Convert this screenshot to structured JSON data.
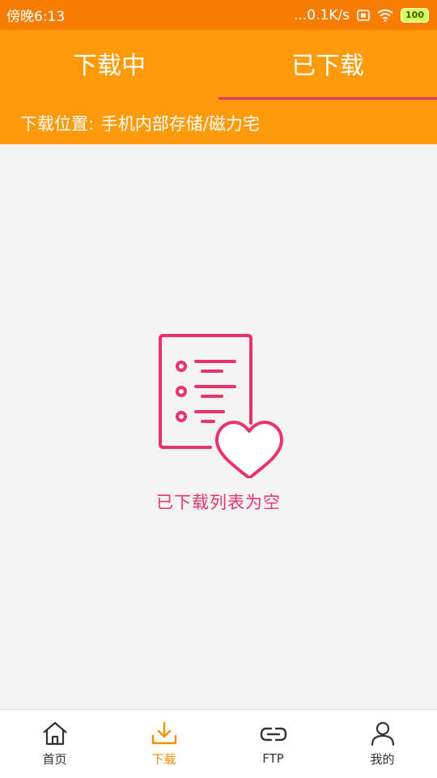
{
  "status_bar": {
    "time": "傍晚6:13",
    "speed": "...0.1K/s",
    "battery": "100"
  },
  "tabs": [
    {
      "label": "下载中",
      "active": false
    },
    {
      "label": "已下载",
      "active": true
    }
  ],
  "location": {
    "label": "下载位置:",
    "path": "手机内部存储/磁力宅"
  },
  "empty_state": {
    "icon": "document-list-heart-icon",
    "message": "已下载列表为空"
  },
  "bottom_nav": [
    {
      "label": "首页",
      "icon": "home-icon",
      "active": false
    },
    {
      "label": "下载",
      "icon": "download-icon",
      "active": true
    },
    {
      "label": "FTP",
      "icon": "link-icon",
      "active": false
    },
    {
      "label": "我的",
      "icon": "user-icon",
      "active": false
    }
  ],
  "colors": {
    "status_bar": "#f77d00",
    "header": "#ff9b0a",
    "accent_pink": "#e8336b",
    "nav_active": "#f59100"
  }
}
